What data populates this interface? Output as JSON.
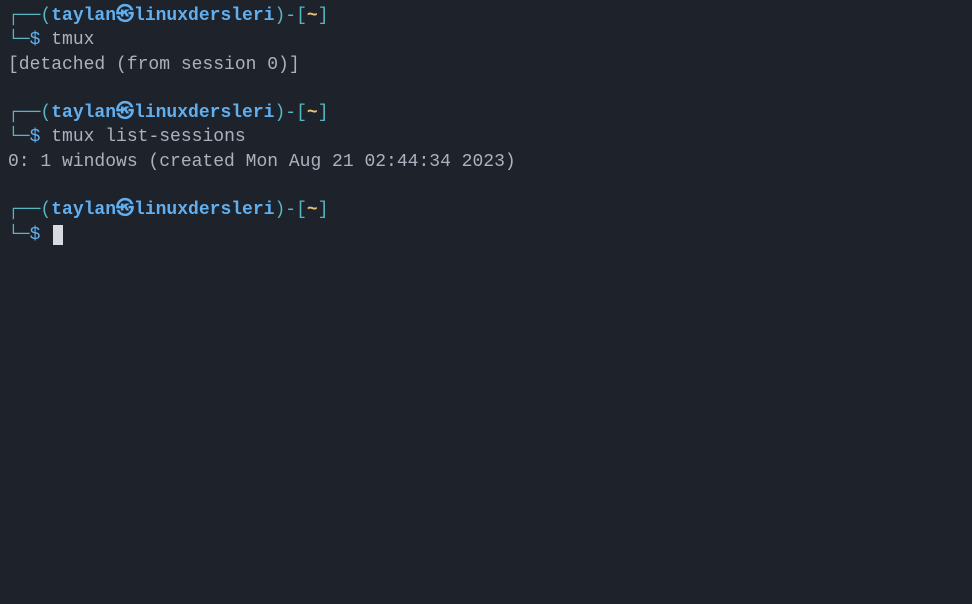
{
  "prompt": {
    "box_top": "┌──",
    "box_bottom": "└─",
    "paren_open": "(",
    "paren_close": ")",
    "dash": "-",
    "bracket_open": "[",
    "bracket_close": "]",
    "user": "taylan",
    "skull": "㉿",
    "host": "linuxdersleri",
    "cwd": "~",
    "dollar": "$"
  },
  "blocks": [
    {
      "command": "tmux",
      "output": "[detached (from session 0)]"
    },
    {
      "command": "tmux list-sessions",
      "output": "0: 1 windows (created Mon Aug 21 02:44:34 2023)"
    },
    {
      "command": "",
      "output": ""
    }
  ]
}
